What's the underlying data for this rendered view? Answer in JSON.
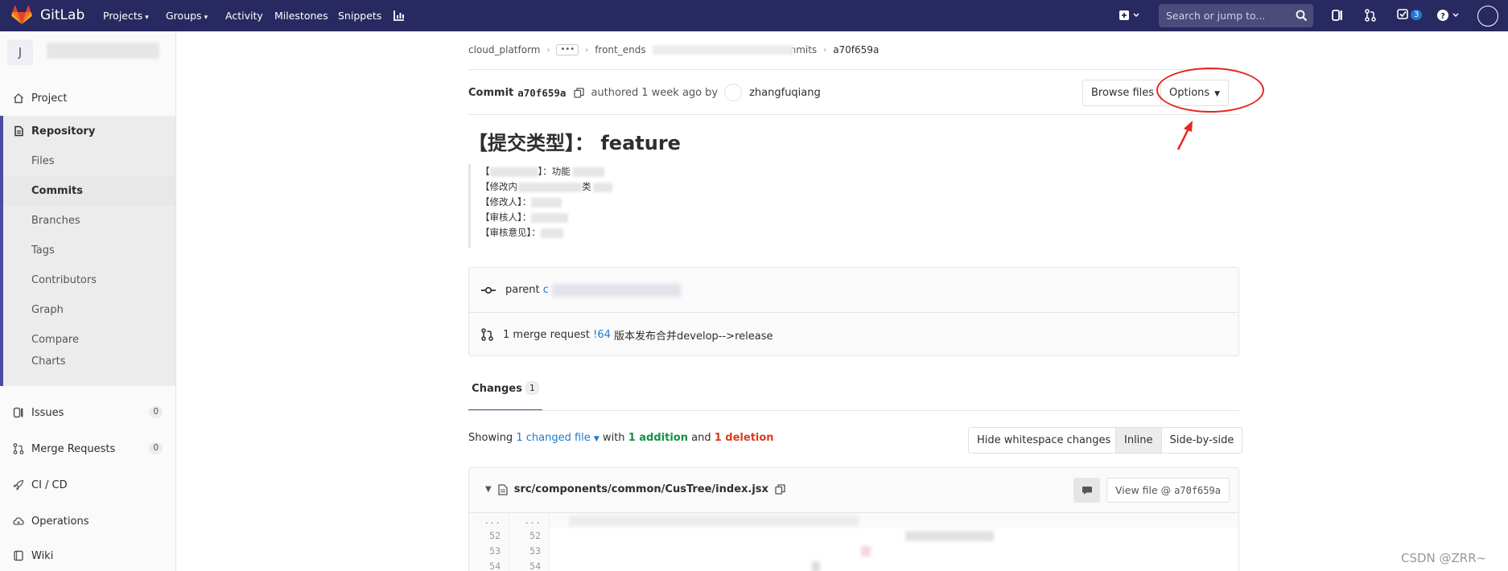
{
  "navbar": {
    "brand": "GitLab",
    "links": [
      {
        "label": "Projects",
        "caret": "▾"
      },
      {
        "label": "Groups",
        "caret": "▾"
      },
      {
        "label": "Activity",
        "caret": ""
      },
      {
        "label": "Milestones",
        "caret": ""
      },
      {
        "label": "Snippets",
        "caret": ""
      }
    ],
    "search_placeholder": "Search or jump to...",
    "todos_count": "3",
    "colors": {
      "bg": "#292961",
      "fox": "#fc6d26"
    }
  },
  "sidebar": {
    "avatar_letter": "J",
    "items_top": [
      {
        "label": "Project",
        "icon": "home-icon"
      },
      {
        "label": "Repository",
        "icon": "repository-icon"
      }
    ],
    "repo_subitems": [
      {
        "label": "Files"
      },
      {
        "label": "Commits"
      },
      {
        "label": "Branches"
      },
      {
        "label": "Tags"
      },
      {
        "label": "Contributors"
      },
      {
        "label": "Graph"
      },
      {
        "label": "Compare"
      },
      {
        "label": "Charts"
      }
    ],
    "items_bottom": [
      {
        "label": "Issues",
        "count": "0",
        "icon": "issues-icon"
      },
      {
        "label": "Merge Requests",
        "count": "0",
        "icon": "merge-request-icon"
      },
      {
        "label": "CI / CD",
        "icon": "rocket-icon"
      },
      {
        "label": "Operations",
        "icon": "cloud-gear-icon"
      },
      {
        "label": "Wiki",
        "icon": "book-icon"
      }
    ],
    "accent": "#4b4ba3"
  },
  "breadcrumb": {
    "items": [
      "cloud_platform",
      "front_ends",
      "nmits",
      "a70f659a"
    ],
    "ellipsis": "•••"
  },
  "commit": {
    "label": "Commit",
    "sha": "a70f659a",
    "authored": "authored",
    "time": "1 week ago",
    "by": "by",
    "author": "zhangfuqiang",
    "title": "【提交类型】： feature",
    "description_lines": [
      {
        "prefix": "【",
        "suffix": "】：功能"
      },
      {
        "prefix": "【修改内",
        "suffix": "类"
      },
      {
        "prefix": "【修改人】：",
        "suffix": ""
      },
      {
        "prefix": "【审核人】：",
        "suffix": ""
      },
      {
        "prefix": "【审核意见】：",
        "suffix": ""
      }
    ]
  },
  "buttons": {
    "browse_files": "Browse files",
    "options": "Options",
    "hide_whitespace": "Hide whitespace changes",
    "inline": "Inline",
    "side_by_side": "Side-by-side"
  },
  "info": {
    "parent_label": "parent",
    "parent_sha_start": "c",
    "mr_count_text": "1 merge request",
    "mr_ref": "!64",
    "mr_title": "版本发布合并develop-->release"
  },
  "tabs": {
    "changes_label": "Changes",
    "changes_count": "1"
  },
  "summary": {
    "showing": "Showing",
    "changed_files": "1 changed file",
    "with": "with",
    "additions": "1 addition",
    "and": "and",
    "deletions": "1 deletion"
  },
  "diff": {
    "file_path": "src/components/common/CusTree/index.jsx",
    "view_file_label": "View file @",
    "view_file_sha": "a70f659a",
    "lines": [
      {
        "old": "...",
        "new": "..."
      },
      {
        "old": "52",
        "new": "52"
      },
      {
        "old": "53",
        "new": "53"
      },
      {
        "old": "54",
        "new": "54"
      }
    ]
  },
  "watermark": "CSDN @ZRR~",
  "annotation_color": "#e8241e"
}
